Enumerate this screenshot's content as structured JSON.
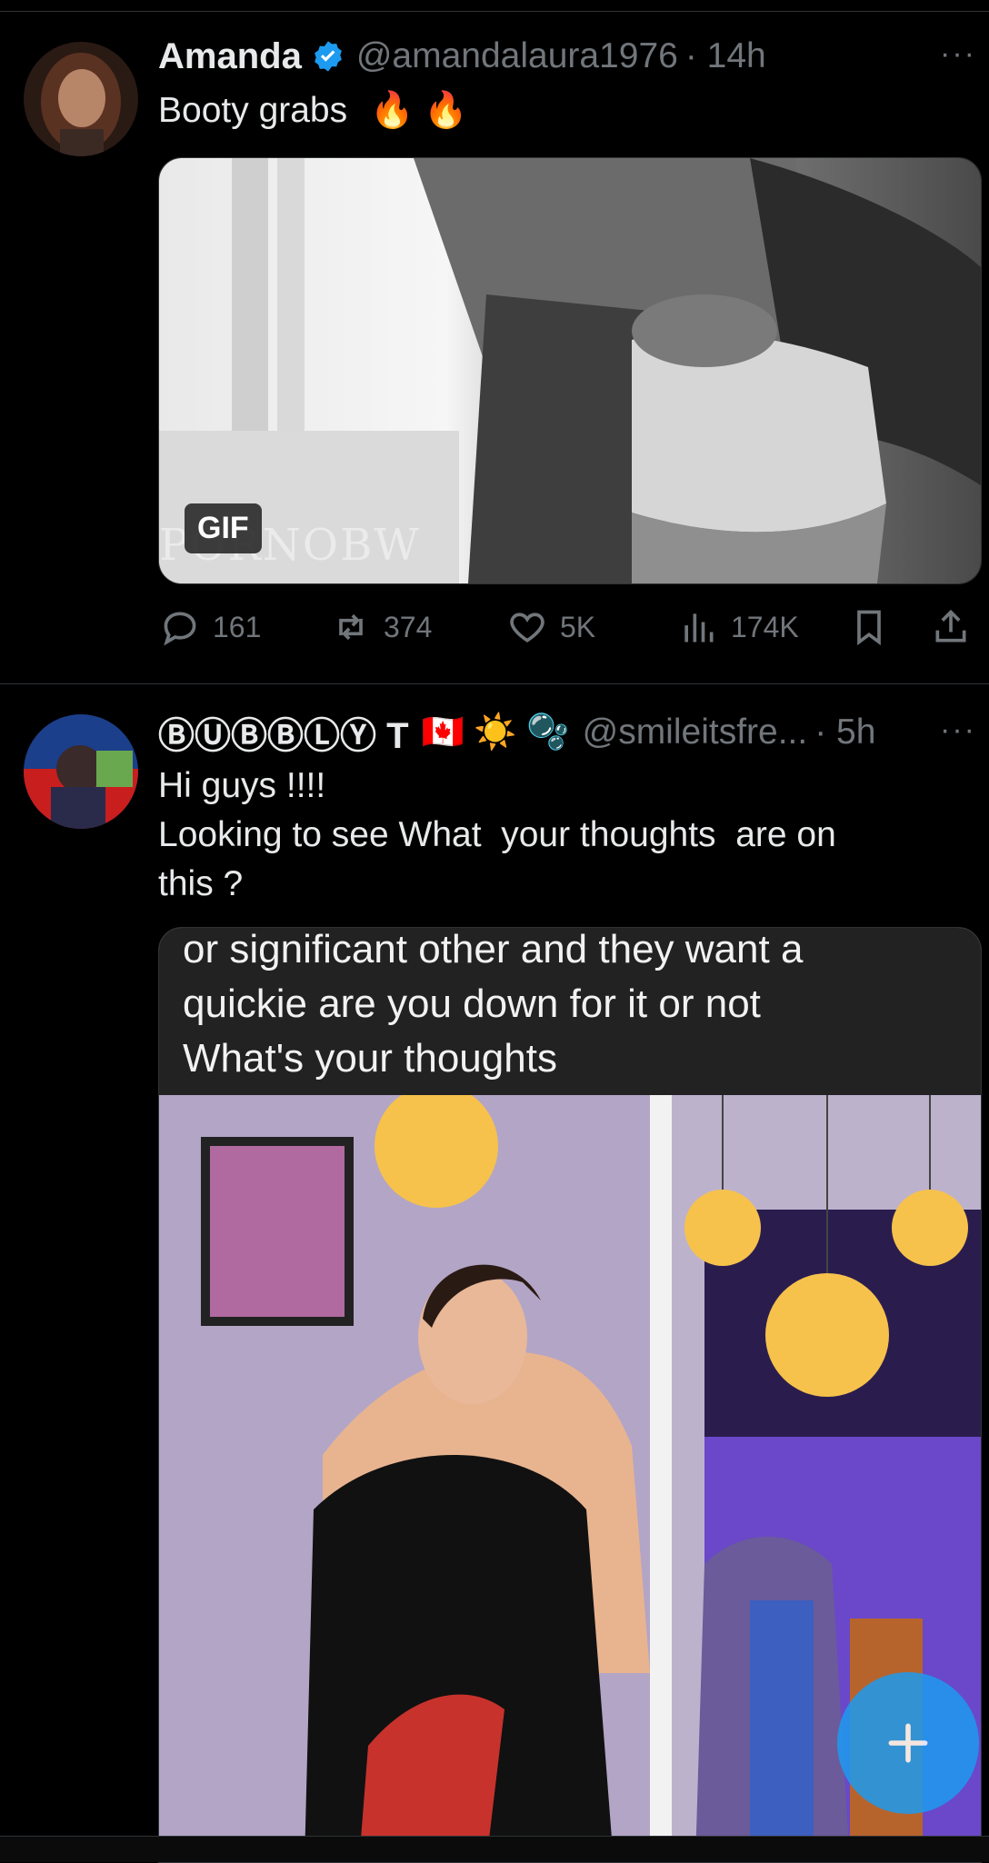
{
  "tweets": [
    {
      "name": "Amanda",
      "handle": "@amandalaura1976",
      "time": "· 14h",
      "text": "Booty grabs",
      "emoji": "🔥 🔥",
      "media": {
        "badge": "GIF",
        "watermark": "PORNOBW"
      },
      "actions": {
        "replies": "161",
        "reposts": "374",
        "likes": "5K",
        "views": "174K"
      }
    },
    {
      "name": "ⒷⓊⒷⒷⓁⓎ T",
      "name_emoji": "🇨🇦 ☀️ 🫧",
      "handle": "@smileitsfre...",
      "time": "· 5h",
      "text_line1": "Hi guys !!!!",
      "text_line2": "Looking to see What  your thoughts  are on",
      "text_line3": "this ?",
      "media": {
        "caption_line1": "or significant other and they want a",
        "caption_line2": "quickie are you down for it or not",
        "caption_line3": "What's your thoughts"
      }
    }
  ],
  "more_label": "···",
  "colors": {
    "accent": "#1d9bf0",
    "muted": "#71767b",
    "text": "#e7e9ea",
    "background": "#000000"
  }
}
